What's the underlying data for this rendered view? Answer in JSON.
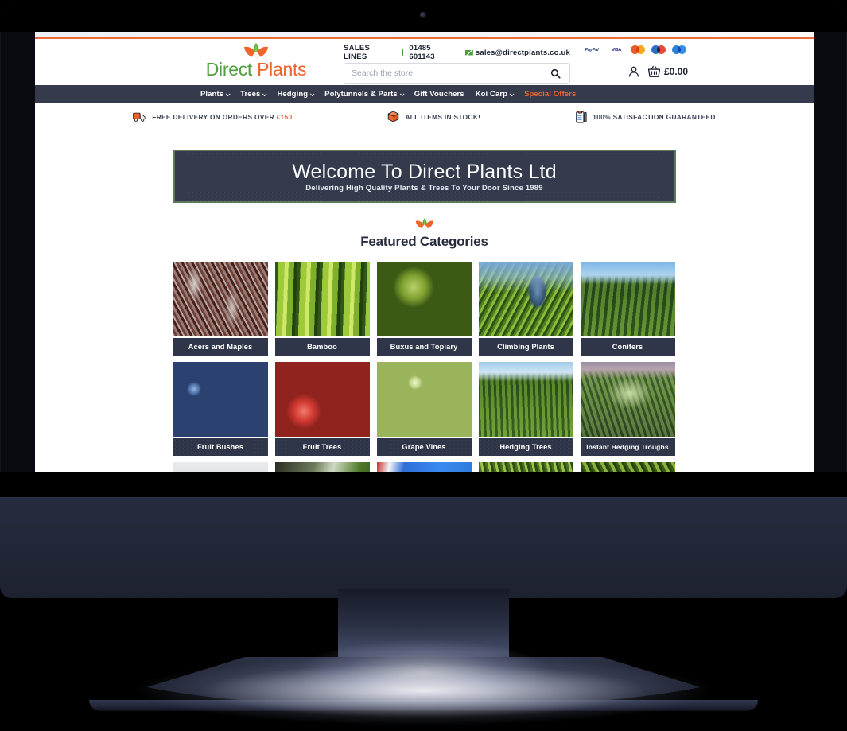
{
  "device": {
    "type": "desktop-monitor",
    "webcam": "webcam-dot"
  },
  "site": {
    "brand": {
      "name_green": "Direct",
      "name_orange": "Plants",
      "logo_icon": "lotus-leaf-logo"
    },
    "contact": {
      "sales_label": "SALES LINES",
      "phone": "01485 601143",
      "email": "sales@directplants.co.uk",
      "phone_icon": "mobile-phone-icon",
      "email_icon": "envelope-icon"
    },
    "search": {
      "placeholder": "Search the store",
      "value": "",
      "icon": "search-icon"
    },
    "payments": [
      {
        "name": "PayPal",
        "label": "PayPal"
      },
      {
        "name": "Visa",
        "label": "VISA"
      },
      {
        "name": "Mastercard",
        "label": ""
      },
      {
        "name": "Maestro",
        "label": ""
      },
      {
        "name": "Amex",
        "label": ""
      }
    ],
    "account": {
      "icon": "user-account-icon",
      "cart_icon": "shopping-basket-icon",
      "cart_total": "£0.00"
    },
    "nav": [
      {
        "label": "Plants",
        "has_dropdown": true,
        "accent": false
      },
      {
        "label": "Trees",
        "has_dropdown": true,
        "accent": false
      },
      {
        "label": "Hedging",
        "has_dropdown": true,
        "accent": false
      },
      {
        "label": "Polytunnels & Parts",
        "has_dropdown": true,
        "accent": false
      },
      {
        "label": "Gift Vouchers",
        "has_dropdown": false,
        "accent": false
      },
      {
        "label": "Koi Carp",
        "has_dropdown": true,
        "accent": false
      },
      {
        "label": "Special Offers",
        "has_dropdown": false,
        "accent": true
      }
    ],
    "benefits": [
      {
        "icon": "delivery-truck-icon",
        "text": "FREE DELIVERY ON ORDERS OVER ",
        "amount": "£150"
      },
      {
        "icon": "package-box-icon",
        "text": "ALL ITEMS IN STOCK!",
        "amount": ""
      },
      {
        "icon": "clipboard-check-icon",
        "text": "100% SATISFACTION GUARANTEED",
        "amount": ""
      }
    ],
    "hero": {
      "title": "Welcome To Direct Plants Ltd",
      "subtitle": "Delivering High Quality Plants & Trees To Your Door Since 1989"
    },
    "featured": {
      "mark_icon": "lotus-leaf-logo",
      "title": "Featured Categories",
      "tiles": [
        {
          "label": "Acers and Maples",
          "image": "acers-maples-foliage"
        },
        {
          "label": "Bamboo",
          "image": "bamboo-canes"
        },
        {
          "label": "Buxus and Topiary",
          "image": "topiary-balls-in-pots"
        },
        {
          "label": "Climbing Plants",
          "image": "climbing-ivy-archway"
        },
        {
          "label": "Conifers",
          "image": "conifer-garden"
        },
        {
          "label": "Fruit Bushes",
          "image": "blueberry-bush"
        },
        {
          "label": "Fruit Trees",
          "image": "red-apples-on-tree"
        },
        {
          "label": "Grape Vines",
          "image": "green-grape-bunch"
        },
        {
          "label": "Hedging Trees",
          "image": "trimmed-green-hedge"
        },
        {
          "label": "Instant Hedging Troughs",
          "image": "hedging-trough-planter"
        },
        {
          "label": "",
          "image": "partial-tile-1"
        },
        {
          "label": "",
          "image": "partial-tile-2"
        },
        {
          "label": "",
          "image": "partial-tile-3"
        },
        {
          "label": "",
          "image": "partial-tile-4"
        },
        {
          "label": "",
          "image": "partial-tile-5"
        }
      ]
    },
    "colors": {
      "accent_orange": "#f0642c",
      "brand_green": "#4f9e3d",
      "dark_navy": "#353b4d",
      "tile_label": "#30364a"
    }
  }
}
